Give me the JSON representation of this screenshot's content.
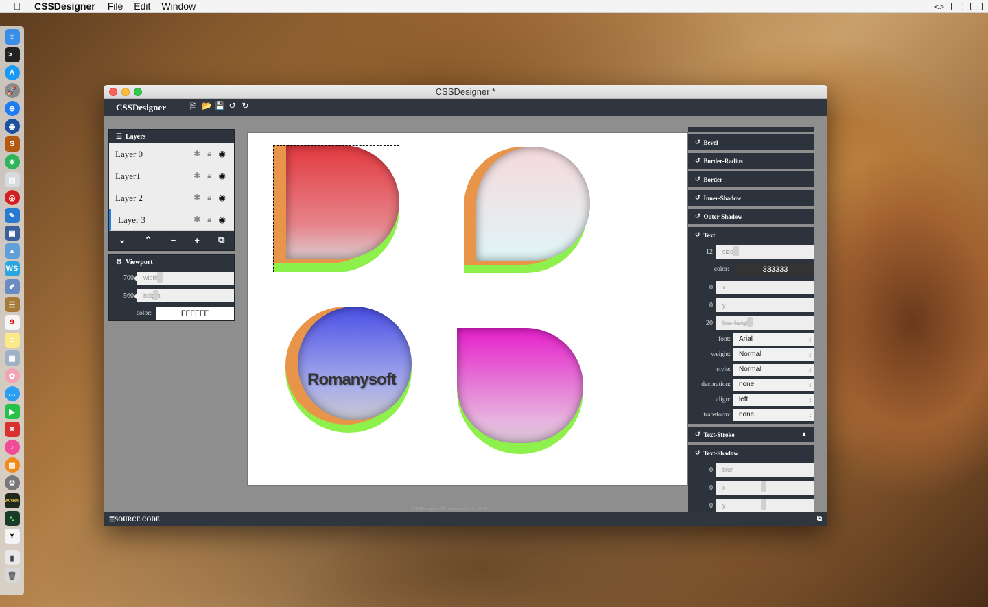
{
  "menubar": {
    "apple_icon": "apple-icon",
    "app": "CSSDesigner",
    "items": [
      "File",
      "Edit",
      "Window"
    ]
  },
  "window": {
    "title": "CSSDesigner *",
    "brand": "CSSDesigner"
  },
  "toolbar": {
    "icons": [
      "new-file-icon",
      "open-folder-icon",
      "save-icon",
      "undo-icon",
      "redo-icon"
    ]
  },
  "layers": {
    "title": "Layers",
    "items": [
      {
        "name": "Layer 0"
      },
      {
        "name": "Layer1"
      },
      {
        "name": "Layer 2"
      },
      {
        "name": "Layer 3"
      }
    ],
    "selected": "Layer 3"
  },
  "viewport": {
    "title": "Viewport",
    "width": "700",
    "width_label": "width",
    "height": "560",
    "height_label": "height",
    "color_label": "color:",
    "color": "FFFFFF"
  },
  "canvas": {
    "text_shape_label": "Romanysoft",
    "copyright": "CSSDesigner ©Romanysoft Lab. 2015"
  },
  "properties": {
    "sections": {
      "bevel": "Bevel",
      "border_radius": "Border-Radius",
      "border": "Border",
      "inner_shadow": "Inner-Shadow",
      "outer_shadow": "Outer-Shadow",
      "text": "Text",
      "text_stroke": "Text-Stroke",
      "text_shadow": "Text-Shadow"
    },
    "text": {
      "size": "12",
      "size_label": "size",
      "color_label": "color:",
      "color": "333333",
      "x": "0",
      "x_label": "x",
      "y": "0",
      "y_label": "y",
      "line_height": "20",
      "line_height_label": "line-height",
      "font_label": "font:",
      "font": "Arial",
      "weight_label": "weight:",
      "weight": "Normal",
      "style_label": "style:",
      "style": "Normal",
      "decoration_label": "decoration:",
      "decoration": "none",
      "align_label": "align:",
      "align": "left",
      "transform_label": "transform:",
      "transform": "none"
    },
    "text_shadow": {
      "blur": "0",
      "blur_label": "blur",
      "x": "0",
      "x_label": "x",
      "y": "0",
      "y_label": "y"
    }
  },
  "footer": {
    "label": "SOURCE CODE"
  },
  "colors": {
    "orange": "#e8954a",
    "green": "#8ef04a",
    "toolbar": "#2f3640"
  }
}
